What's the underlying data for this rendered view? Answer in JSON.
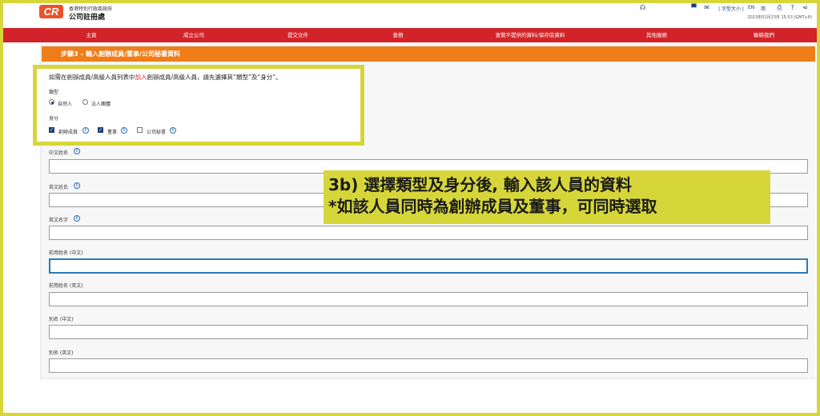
{
  "header": {
    "logo_text": "CR",
    "org_line1": "香港特別行政區政府",
    "org_line2": "公司註冊處",
    "font_size_label": "字型大小",
    "lang_en": "EN",
    "lang_sc": "简",
    "datetime": "2023年01月23日 15:53 (GMT+8)",
    "icons": [
      "headset-icon",
      "cart-icon",
      "mail-icon",
      "print-icon",
      "search-icon",
      "help-icon",
      "share-icon"
    ]
  },
  "nav": {
    "items": [
      "主頁",
      "成立公司",
      "提交文件",
      "查冊",
      "查覽不提供的資料/保存區資料",
      "其他服務",
      "聯絡我們"
    ]
  },
  "step": {
    "title": "步驟3 – 輸入創辦成員/董事/公司秘書資料"
  },
  "form": {
    "instruction_pre": "如需在創辦成員/高級人員列表中",
    "instruction_red": "加入",
    "instruction_post": "創辦成員/高級人員，請先選擇其“類型”及“身分”。",
    "type_label": "類型",
    "type_options": [
      {
        "label": "自然人",
        "selected": true
      },
      {
        "label": "法人團體",
        "selected": false
      }
    ],
    "identity_label": "身分",
    "identity_options": [
      {
        "label": "創辦成員",
        "checked": true
      },
      {
        "label": "董事",
        "checked": true
      },
      {
        "label": "公司秘書",
        "checked": false
      }
    ],
    "fields": [
      {
        "label": "中文姓名",
        "value": "",
        "focused": false
      },
      {
        "label": "英文姓氏",
        "value": "",
        "focused": false
      },
      {
        "label": "英文名字",
        "value": "",
        "focused": false
      },
      {
        "label": "前用姓名 (中文)",
        "value": "",
        "focused": true
      },
      {
        "label": "前用姓名 (英文)",
        "value": "",
        "focused": false
      },
      {
        "label": "別名 (中文)",
        "value": "",
        "focused": false
      },
      {
        "label": "別名 (英文)",
        "value": "",
        "focused": false
      }
    ]
  },
  "annotation": {
    "line1": "3b) 選擇類型及身分後, 輸入該人員的資料",
    "line2": "*如該人員同時為創辦成員及董事，可同時選取"
  },
  "colors": {
    "nav_red": "#d2232a",
    "step_orange": "#ef7d1a",
    "highlight_yellow": "#d6d63a",
    "focus_blue": "#2a7ab8",
    "brand_navy": "#1a3d7c"
  }
}
